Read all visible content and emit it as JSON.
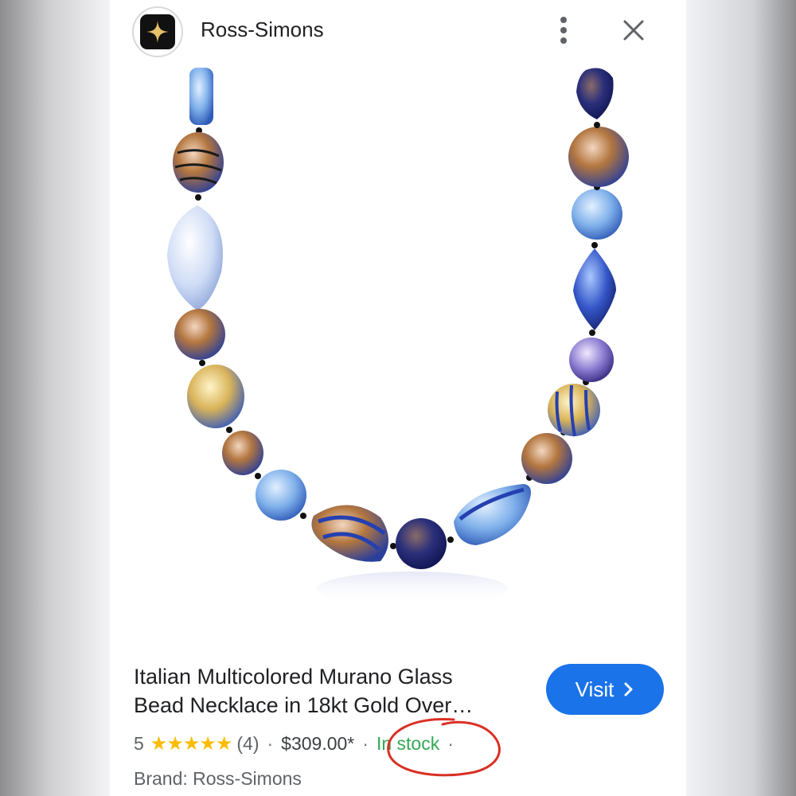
{
  "header": {
    "brand": "Ross-Simons",
    "logo_icon": "four-point-star-icon",
    "menu_icon": "vertical-dots-icon",
    "close_icon": "close-icon"
  },
  "product": {
    "title_line1": "Italian Multicolored Murano Glass",
    "title_line2": "Bead Necklace in 18kt Gold Over…",
    "rating_value": "5",
    "stars": "★★★★★",
    "review_count": "(4)",
    "price": "$309.00*",
    "stock": "In stock",
    "brand_line": "Brand: Ross-Simons"
  },
  "actions": {
    "visit_label": "Visit"
  },
  "colors": {
    "accent": "#1a73e8",
    "stock_green": "#34a853",
    "star_yellow": "#fbbc04",
    "annotation_red": "#d93025"
  }
}
